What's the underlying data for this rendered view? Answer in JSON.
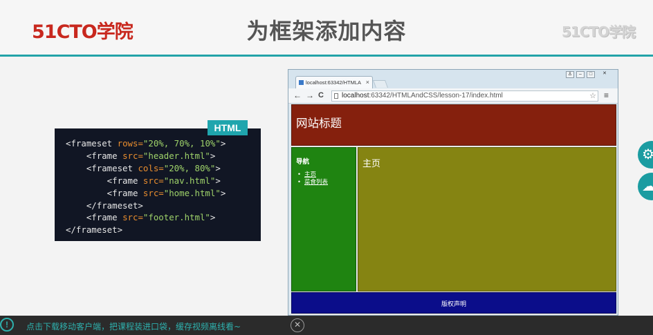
{
  "slide": {
    "logo_left": "51CTO学院",
    "title": "为框架添加内容",
    "logo_right": "51CTO学院"
  },
  "code_panel": {
    "badge": "HTML",
    "lines": [
      [
        [
          "tag",
          "<frameset "
        ],
        [
          "attr",
          "rows="
        ],
        [
          "val",
          "\"20%, 70%, 10%\""
        ],
        [
          "tag",
          ">"
        ]
      ],
      [
        [
          "tag",
          "    <frame "
        ],
        [
          "attr",
          "src="
        ],
        [
          "val",
          "\"header.html\""
        ],
        [
          "tag",
          ">"
        ]
      ],
      [
        [
          "tag",
          "    <frameset "
        ],
        [
          "attr",
          "cols="
        ],
        [
          "val",
          "\"20%, 80%\""
        ],
        [
          "tag",
          ">"
        ]
      ],
      [
        [
          "tag",
          "        <frame "
        ],
        [
          "attr",
          "src="
        ],
        [
          "val",
          "\"nav.html\""
        ],
        [
          "tag",
          ">"
        ]
      ],
      [
        [
          "tag",
          "        <frame "
        ],
        [
          "attr",
          "src="
        ],
        [
          "val",
          "\"home.html\""
        ],
        [
          "tag",
          ">"
        ]
      ],
      [
        [
          "tag",
          "    </frameset>"
        ]
      ],
      [
        [
          "tag",
          "    <frame "
        ],
        [
          "attr",
          "src="
        ],
        [
          "val",
          "\"footer.html\""
        ],
        [
          "tag",
          ">"
        ]
      ],
      [
        [
          "tag",
          "</frameset>"
        ]
      ]
    ]
  },
  "browser": {
    "tab_title": "localhost:63342/HTMLA",
    "tab_close": "×",
    "url_host": "localhost",
    "url_path": ":63342/HTMLAndCSS/lesson-17/index.html",
    "back": "←",
    "forward": "→",
    "reload": "C",
    "star": "☆",
    "menu": "≡",
    "win_minimize": "–",
    "win_maximize": "□",
    "win_close": "✕"
  },
  "page": {
    "header_title": "网站标题",
    "nav_title": "导航",
    "nav_items": [
      "主页",
      "菜食列表"
    ],
    "home_title": "主页",
    "footer": "版权声明"
  },
  "side_buttons": {
    "settings_glyph": "⚙",
    "cloud_glyph": "☁"
  },
  "notice": {
    "icon": "!",
    "text": "点击下载移动客户端，把课程装进口袋，缓存视频离线看~",
    "close": "✕"
  }
}
